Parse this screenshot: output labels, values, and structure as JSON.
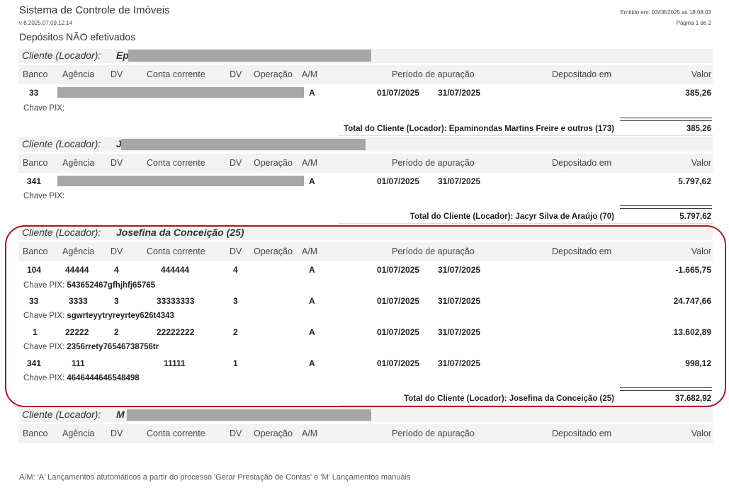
{
  "header": {
    "system_title": "Sistema de Controle de Imóveis",
    "version": "v 8.2025.07.09.12.14",
    "report_title": "Depósitos NÃO efetivados",
    "emitted": "Emitido em: 03/08/2025 as 18:08:03",
    "page": "Página 1 de 2"
  },
  "columns": {
    "banco": "Banco",
    "agencia": "Agência",
    "dv": "DV",
    "conta": "Conta corrente",
    "dv2": "DV",
    "operacao": "Operação",
    "am": "A/M",
    "periodo": "Período de apuração",
    "depositado": "Depositado em",
    "valor": "Valor"
  },
  "client_label": "Cliente (Locador):",
  "pix_label": "Chave PIX:",
  "clients": [
    {
      "name": "Ep",
      "rows": [
        {
          "banco": "33",
          "agencia": "",
          "dv": "",
          "conta": "",
          "dv2": "",
          "am": "A",
          "inicio": "01/07/2025",
          "fim": "31/07/2025",
          "valor": "385,26",
          "pix": ""
        }
      ],
      "total_label": "Total do Cliente (Locador): Epaminondas Martins Freire e outros (173)",
      "total_value": "385,26"
    },
    {
      "name": "J",
      "rows": [
        {
          "banco": "341",
          "agencia": "",
          "dv": "",
          "conta": "",
          "dv2": "",
          "am": "A",
          "inicio": "01/07/2025",
          "fim": "31/07/2025",
          "valor": "5.797,62",
          "pix": ""
        }
      ],
      "total_label": "Total do Cliente (Locador): Jacyr Silva de Araújo (70)",
      "total_value": "5.797,62"
    },
    {
      "name": "Josefina da Conceição (25)",
      "rows": [
        {
          "banco": "104",
          "agencia": "44444",
          "dv": "4",
          "conta": "444444",
          "dv2": "4",
          "am": "A",
          "inicio": "01/07/2025",
          "fim": "31/07/2025",
          "valor": "-1.665,75",
          "pix": "543652467gfhjhfj65765"
        },
        {
          "banco": "33",
          "agencia": "3333",
          "dv": "3",
          "conta": "33333333",
          "dv2": "3",
          "am": "A",
          "inicio": "01/07/2025",
          "fim": "31/07/2025",
          "valor": "24.747,66",
          "pix": "sgwrteyytryreyrtey626t4343"
        },
        {
          "banco": "1",
          "agencia": "22222",
          "dv": "2",
          "conta": "22222222",
          "dv2": "2",
          "am": "A",
          "inicio": "01/07/2025",
          "fim": "31/07/2025",
          "valor": "13.602,89",
          "pix": "2356rrety76546738756tr"
        },
        {
          "banco": "341",
          "agencia": "111",
          "dv": "",
          "conta": "11111",
          "dv2": "1",
          "am": "A",
          "inicio": "01/07/2025",
          "fim": "31/07/2025",
          "valor": "998,12",
          "pix": "4646444646548498"
        }
      ],
      "total_label": "Total do Cliente (Locador): Josefina da Conceição (25)",
      "total_value": "37.682,92"
    },
    {
      "name": "M",
      "rows": [],
      "total_label": "",
      "total_value": ""
    }
  ],
  "footnote": "A/M: 'A' Lançamentos atutomáticos a partir do processo 'Gerar Prestação de Contas'  e 'M'  Lançamentos manuais",
  "colors": {
    "highlight": "#b0181c",
    "band": "#f2f2f2",
    "redaction": "#a6a6a6"
  }
}
